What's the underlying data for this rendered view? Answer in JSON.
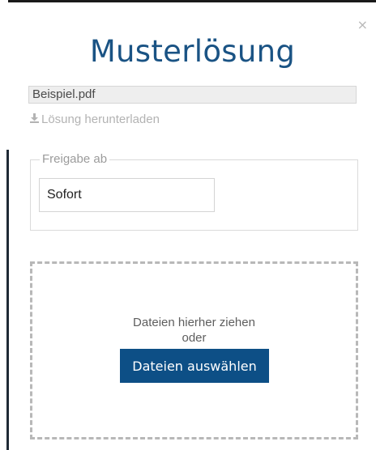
{
  "modal": {
    "title": "Musterlösung",
    "close_label": "×",
    "file": {
      "name": "Beispiel.pdf"
    },
    "download": {
      "label": "Lösung herunterladen",
      "icon": "download-icon"
    },
    "release": {
      "legend": "Freigabe ab",
      "value": "Sofort"
    },
    "upload": {
      "drop_text_line1": "Dateien hierher ziehen",
      "drop_text_line2": "oder",
      "select_button": "Dateien auswählen"
    }
  },
  "colors": {
    "title": "#1a5384",
    "button_bg": "#0d4f86",
    "link": "#b3b3b3",
    "dash_border": "#b8b8b8"
  }
}
